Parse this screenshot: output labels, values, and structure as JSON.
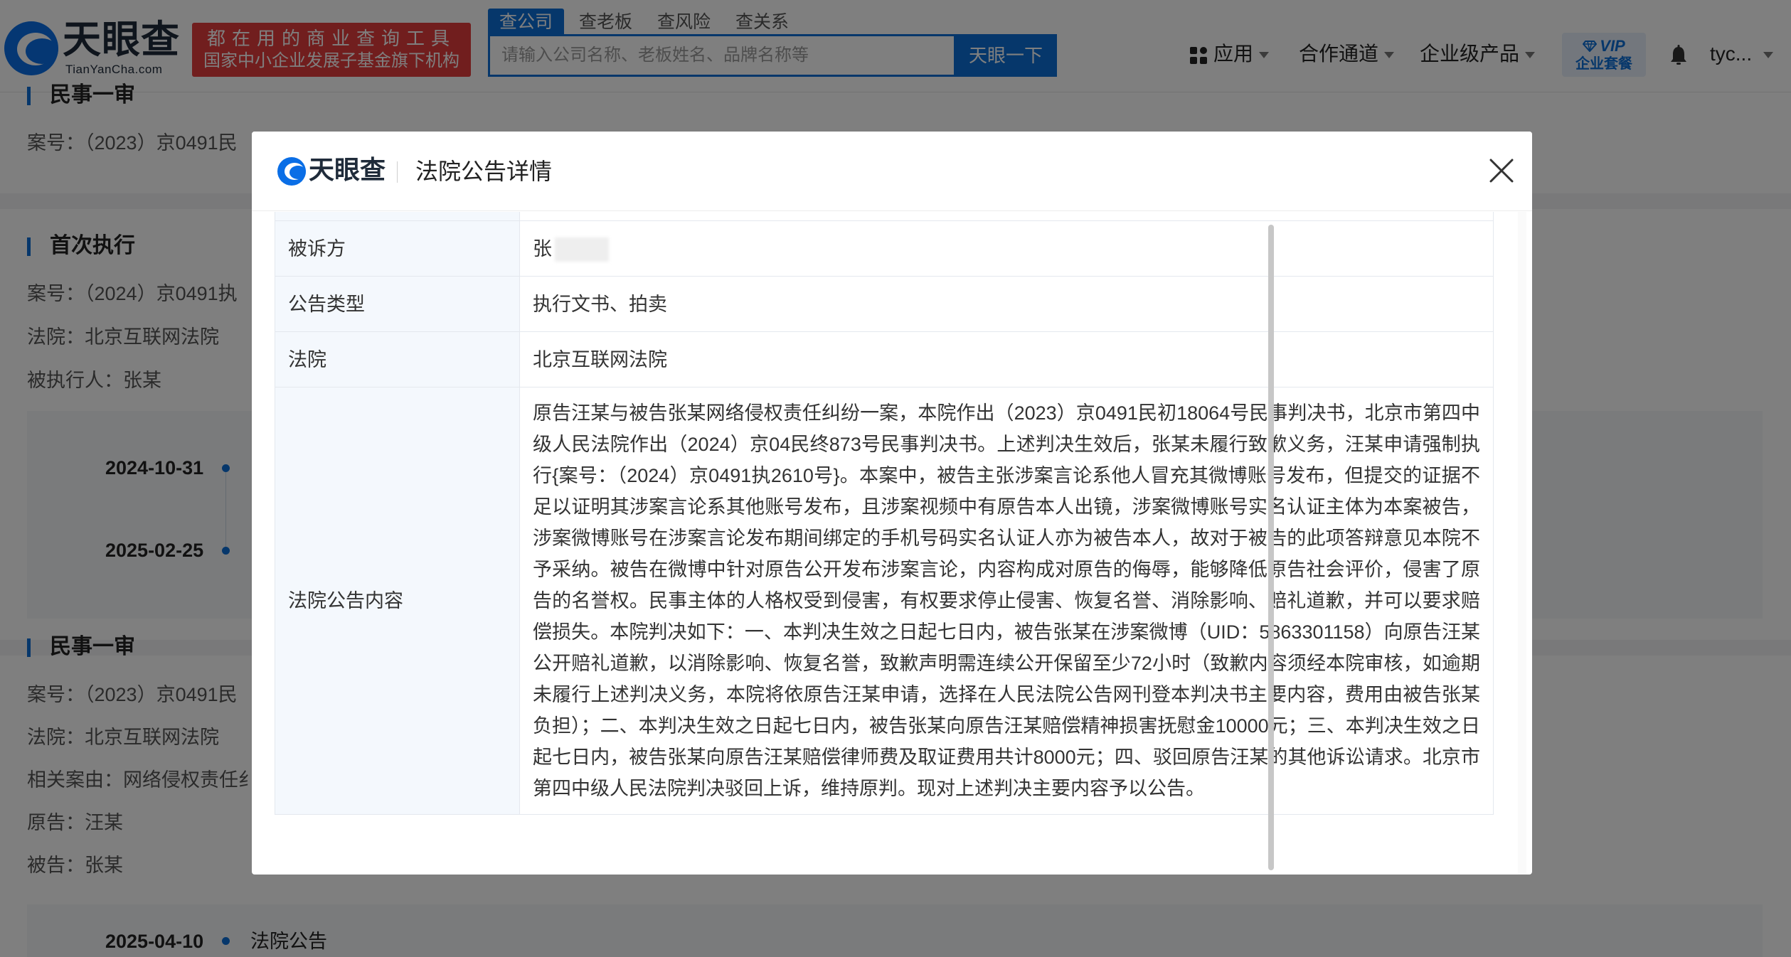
{
  "header": {
    "logo_cn": "天眼查",
    "logo_en": "TianYanCha.com",
    "promo_line1": "都在用的商业查询工具",
    "promo_line2": "国家中小企业发展子基金旗下机构",
    "search_tabs": [
      "查公司",
      "查老板",
      "查风险",
      "查关系"
    ],
    "active_tab": "查公司",
    "search_placeholder": "请输入公司名称、老板姓名、品牌名称等",
    "search_button": "天眼一下",
    "nav": {
      "apps": "应用",
      "partner": "合作通道",
      "enterprise": "企业级产品"
    },
    "vip_top": "VIP",
    "vip_bottom": "企业套餐",
    "user": "tyc..."
  },
  "background": {
    "sec1": {
      "title": "民事一审",
      "case_no": "案号：（2023）京0491民"
    },
    "sec2": {
      "title": "首次执行",
      "case_no": "案号：（2024）京0491执",
      "court": "法院：北京互联网法院",
      "executed": "被执行人：张某",
      "timeline": [
        {
          "date": "2024-10-31"
        },
        {
          "date": "2025-02-25"
        }
      ]
    },
    "sec3": {
      "title": "民事一审",
      "case_no": "案号：（2023）京0491民",
      "court": "法院：北京互联网法院",
      "cause": "相关案由：网络侵权责任纟",
      "plaintiff": "原告：汪某",
      "defendant": "被告：张某",
      "timeline": [
        {
          "date": "2025-04-10",
          "text": "法院公告"
        }
      ]
    }
  },
  "modal": {
    "logo_text": "天眼查",
    "title": "法院公告详情",
    "rows": {
      "defendant_label": "被诉方",
      "defendant_value": "张",
      "type_label": "公告类型",
      "type_value": "执行文书、拍卖",
      "court_label": "法院",
      "court_value": "北京互联网法院",
      "content_label": "法院公告内容",
      "content_value": "原告汪某与被告张某网络侵权责任纠纷一案，本院作出（2023）京0491民初18064号民事判决书，北京市第四中级人民法院作出（2024）京04民终873号民事判决书。上述判决生效后，张某未履行致歉义务，汪某申请强制执行{案号：（2024）京0491执2610号}。本案中，被告主张涉案言论系他人冒充其微博账号发布，但提交的证据不足以证明其涉案言论系其他账号发布，且涉案视频中有原告本人出镜，涉案微博账号实名认证主体为本案被告，涉案微博账号在涉案言论发布期间绑定的手机号码实名认证人亦为被告本人，故对于被告的此项答辩意见本院不予采纳。被告在微博中针对原告公开发布涉案言论，内容构成对原告的侮辱，能够降低原告社会评价，侵害了原告的名誉权。民事主体的人格权受到侵害，有权要求停止侵害、恢复名誉、消除影响、赔礼道歉，并可以要求赔偿损失。本院判决如下：一、本判决生效之日起七日内，被告张某在涉案微博（UID：5863301158）向原告汪某公开赔礼道歉，以消除影响、恢复名誉，致歉声明需连续公开保留至少72小时（致歉内容须经本院审核，如逾期未履行上述判决义务，本院将依原告汪某申请，选择在人民法院公告网刊登本判决书主要内容，费用由被告张某负担）；二、本判决生效之日起七日内，被告张某向原告汪某赔偿精神损害抚慰金10000元；三、本判决生效之日起七日内，被告张某向原告汪某赔偿律师费及取证费用共计8000元；四、驳回原告汪某的其他诉讼请求。北京市第四中级人民法院判决驳回上诉，维持原判。现对上述判决主要内容予以公告。"
    }
  },
  "colors": {
    "brand_blue": "#0c6fd6",
    "promo_red": "#e33c3c",
    "overlay": "rgba(0,0,0,0.5)"
  },
  "icons": [
    "apps-grid-icon",
    "caret-down-icon",
    "diamond-icon",
    "bell-icon",
    "close-icon",
    "tianyancha-logo-icon"
  ]
}
